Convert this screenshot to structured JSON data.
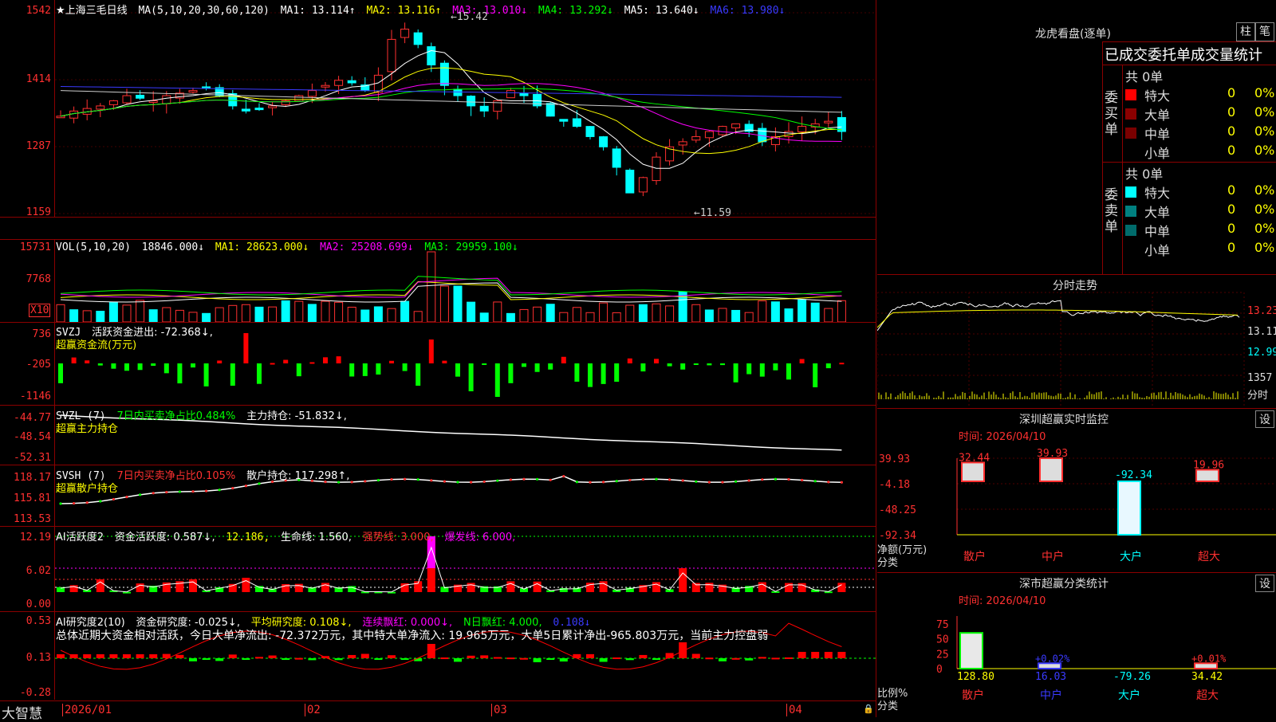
{
  "main_chart": {
    "title": "★上海三毛日线",
    "ma_params": "MA(5,10,20,30,60,120)",
    "ma1": "MA1: 13.114↑",
    "ma2": "MA2: 13.116↑",
    "ma3": "MA3: 13.010↓",
    "ma4": "MA4: 13.292↓",
    "ma5": "MA5: 13.640↓",
    "ma6": "MA6: 13.980↓",
    "y_ticks": [
      "1542",
      "1414",
      "1287",
      "1159"
    ],
    "high_label": "15.42",
    "low_label": "11.59"
  },
  "volume": {
    "header": "VOL(5,10,20)",
    "vol": "18846.000↓",
    "ma1": "MA1: 28623.000↓",
    "ma2": "MA2: 25208.699↓",
    "ma3": "MA3: 29959.100↓",
    "y_ticks": [
      "15731",
      "7768"
    ],
    "unit": "X10"
  },
  "svzj": {
    "header": "SVZJ",
    "text": "活跃资金进出: -72.368↓,",
    "subtitle": "超赢资金流(万元)",
    "y_ticks": [
      "736",
      "-205",
      "-1146"
    ]
  },
  "svzl": {
    "header": "SVZL (7)",
    "text1": "7日内买卖净占比0.484%",
    "text2": "主力持仓: -51.832↓,",
    "subtitle": "超赢主力持仓",
    "y_ticks": [
      "-44.77",
      "-48.54",
      "-52.31"
    ]
  },
  "svsh": {
    "header": "SVSH (7)",
    "text1": "7日内买卖净占比0.105%",
    "text2": "散户持仓: 117.298↑,",
    "subtitle": "超赢散户持仓",
    "y_ticks": [
      "118.17",
      "115.81",
      "113.53"
    ]
  },
  "ai_active": {
    "header": "AI活跃度2",
    "t1": "资金活跃度: 0.587↓,",
    "t2": "12.186,",
    "t3": "生命线: 1.560,",
    "t4": "强势线: 3.000,",
    "t5": "爆发线: 6.000,",
    "y_ticks": [
      "12.19",
      "6.02",
      "0.00"
    ]
  },
  "ai_research": {
    "header": "AI研究度2(10)",
    "t1": "资金研究度: -0.025↓,",
    "t2": "平均研究度: 0.108↓,",
    "t3": "连续飘红: 0.000↓,",
    "t4": "N日飘红: 4.000,",
    "t5": "0.108↓",
    "summary": "总体近期大资金相对活跃，今日大单净流出: -72.372万元，其中特大单净流入: 19.965万元，大单5日累计净出-965.803万元，当前主力控盘弱",
    "y_ticks": [
      "0.53",
      "0.13",
      "-0.28"
    ]
  },
  "bottom_bar": {
    "brand": "大智慧",
    "dates": [
      "2026/01",
      "02",
      "03",
      "04"
    ]
  },
  "longhu": {
    "title": "龙虎看盘(逐单)",
    "btn_zhu": "柱",
    "btn_bi": "笔",
    "header": "已成交委托单成交量统计",
    "buy_label": "委买单",
    "sell_label": "委卖单",
    "buy_total": "共 0单",
    "sell_total": "共 0单",
    "rows": [
      {
        "name": "特大",
        "val": "0",
        "pct": "0%"
      },
      {
        "name": "大单",
        "val": "0",
        "pct": "0%"
      },
      {
        "name": "中单",
        "val": "0",
        "pct": "0%"
      },
      {
        "name": "小单",
        "val": "0",
        "pct": "0%"
      }
    ]
  },
  "intraday": {
    "title": "分时走势",
    "y_ticks": [
      "13.23",
      "13.11",
      "12.99"
    ],
    "vol_tick": "1357",
    "vol_unit": "分时"
  },
  "sz_monitor": {
    "title": "深圳超赢实时监控",
    "btn": "设",
    "time": "时间: 2026/04/10",
    "y_ticks": [
      "39.93",
      "-4.18",
      "-48.25",
      "-92.34"
    ],
    "y_label1": "净额(万元)",
    "y_label2": "分类",
    "bars": [
      {
        "cat": "散户",
        "value": 32.44,
        "label": "32.44"
      },
      {
        "cat": "中户",
        "value": 39.93,
        "label": "39.93"
      },
      {
        "cat": "大户",
        "value": -92.34,
        "label": "-92.34"
      },
      {
        "cat": "超大",
        "value": 19.96,
        "label": "19.96"
      }
    ]
  },
  "sz_class": {
    "title": "深市超赢分类统计",
    "btn": "设",
    "time": "时间: 2026/04/10",
    "y_ticks": [
      "75",
      "50",
      "25",
      "0"
    ],
    "y_label1": "比例%",
    "y_label2": "分类",
    "bars": [
      {
        "cat": "散户",
        "value": 128.8,
        "label": "128.80",
        "pct": ""
      },
      {
        "cat": "中户",
        "value": 16.03,
        "label": "16.03",
        "pct": "+0.02%"
      },
      {
        "cat": "大户",
        "value": -79.26,
        "label": "-79.26",
        "pct": ""
      },
      {
        "cat": "超大",
        "value": 34.42,
        "label": "34.42",
        "pct": "+0.01%"
      }
    ]
  }
}
